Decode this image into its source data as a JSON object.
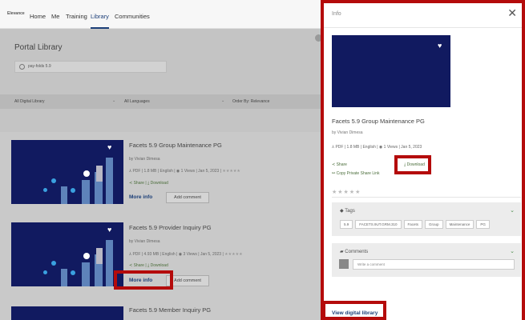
{
  "nav": {
    "logo": "Elevance",
    "items": [
      "Home",
      "Me",
      "Training",
      "Library",
      "Communities"
    ],
    "active": "Library"
  },
  "library": {
    "title": "Portal Library",
    "search_value": "pay-folds 5.9",
    "filters": [
      "All Digital Library",
      "All Languages",
      "Order By: Relevance"
    ]
  },
  "cards": [
    {
      "title": "Facets 5.9 Group Maintenance PG",
      "author": "by Vivian Dimesa",
      "meta": "PDF | 1.8 MB | English | ◉ 1 Views | Jan 5, 2023 |",
      "stars": "★★★★★",
      "share": "Share",
      "download": "Download",
      "more_info": "More info",
      "add_comment": "Add comment"
    },
    {
      "title": "Facets 5.9 Provider Inquiry PG",
      "author": "by Vivian Dimesa",
      "meta": "PDF | 4.93 MB | English | ◉ 3 Views | Jan 5, 2023 |",
      "stars": "★★★★★",
      "share": "Share",
      "download": "Download",
      "more_info": "More info",
      "add_comment": "Add comment"
    },
    {
      "title": "Facets 5.9 Member Inquiry PG"
    }
  ],
  "drawer": {
    "header": "Info",
    "close": "✕",
    "title": "Facets 5.9 Group Maintenance PG",
    "author": "by Vivian Dimesa",
    "meta": "PDF | 1.8 MB | English | ◉ 1 Views | Jan 5, 2023",
    "share": "Share",
    "download": "Download",
    "copy_link": "Copy Private Share Link",
    "stars": "★★★★★",
    "tags_label": "Tags",
    "tags": [
      "5.9",
      "FACETS.9UT.GRM.310",
      "Facets",
      "Group",
      "Maintenance",
      "PG"
    ],
    "comments_label": "Comments",
    "comment_placeholder": "Write a comment",
    "view_digital_library": "View digital library"
  },
  "colors": {
    "highlight": "#b40b0b",
    "link": "#1c3f78",
    "thumb_bg": "#111a60"
  }
}
